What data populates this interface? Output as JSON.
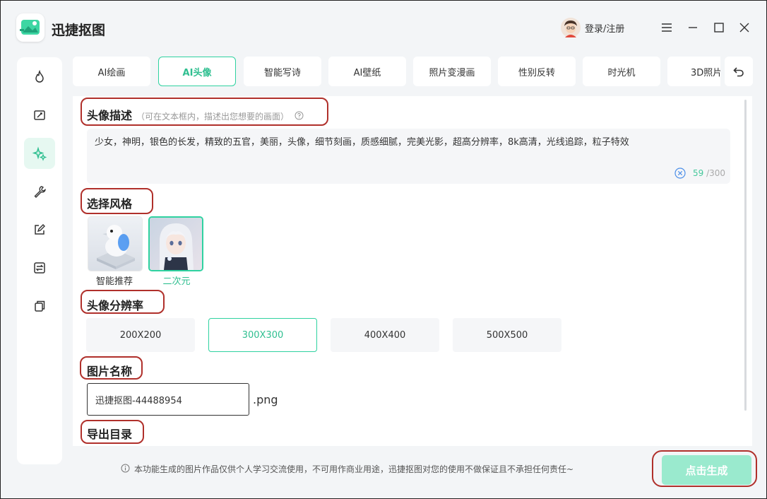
{
  "app": {
    "title": "迅捷抠图"
  },
  "header": {
    "login_label": "登录/注册"
  },
  "tabs": [
    {
      "label": "AI绘画"
    },
    {
      "label": "AI头像"
    },
    {
      "label": "智能写诗"
    },
    {
      "label": "AI壁纸"
    },
    {
      "label": "照片变漫画"
    },
    {
      "label": "性别反转"
    },
    {
      "label": "时光机"
    },
    {
      "label": "3D照片"
    }
  ],
  "sections": {
    "description": {
      "title": "头像描述",
      "hint": "（可在文本框内，描述出您想要的画面）",
      "text": "少女，神明，银色的长发，精致的五官，美丽，头像，细节刻画，质感细腻，完美光影，超高分辨率，8k高清，光线追踪，粒子特效",
      "char_count": "59",
      "char_max": "/300"
    },
    "style": {
      "title": "选择风格",
      "options": [
        {
          "label": "智能推荐"
        },
        {
          "label": "二次元"
        }
      ],
      "selected": "二次元"
    },
    "resolution": {
      "title": "头像分辨率",
      "options": [
        "200X200",
        "300X300",
        "400X400",
        "500X500"
      ],
      "selected": "300X300"
    },
    "filename": {
      "title": "图片名称",
      "value": "迅捷抠图-44488954",
      "extension": ".png"
    },
    "export": {
      "title": "导出目录"
    }
  },
  "footer": {
    "disclaimer": "本功能生成的图片作品仅供个人学习交流使用，不可用作商业用途，迅捷抠图对您的使用不做保证且不承担任何责任~",
    "generate_label": "点击生成"
  },
  "colors": {
    "accent": "#2fd2a0",
    "accent_text": "#2fbf90",
    "annotation": "#b0302b",
    "generate_button": "#9aeace"
  }
}
